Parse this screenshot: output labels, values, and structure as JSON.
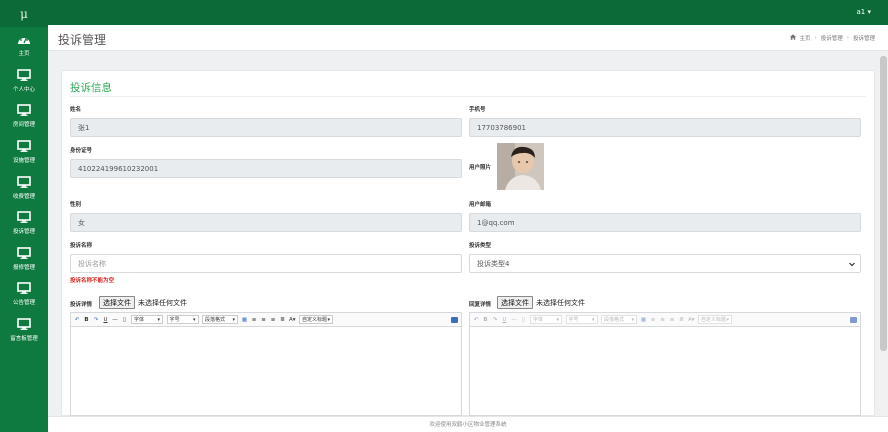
{
  "app": {
    "logo": "μ"
  },
  "sidebar": {
    "items": [
      {
        "label": "主页",
        "icon": "dashboard-icon"
      },
      {
        "label": "个人中心",
        "icon": "monitor-icon"
      },
      {
        "label": "房间管理",
        "icon": "monitor-icon"
      },
      {
        "label": "设施管理",
        "icon": "monitor-icon"
      },
      {
        "label": "收费管理",
        "icon": "monitor-icon"
      },
      {
        "label": "投诉管理",
        "icon": "monitor-icon"
      },
      {
        "label": "报修管理",
        "icon": "monitor-icon"
      },
      {
        "label": "公告管理",
        "icon": "monitor-icon"
      },
      {
        "label": "留言板管理",
        "icon": "monitor-icon"
      }
    ]
  },
  "header": {
    "user": "a1 ▾"
  },
  "page": {
    "title": "投诉管理",
    "breadcrumb": [
      "主页",
      "投诉管理",
      "投诉管理"
    ]
  },
  "form": {
    "title": "投诉信息",
    "name": {
      "label": "姓名",
      "value": "张1"
    },
    "phone": {
      "label": "手机号",
      "value": "17703786901"
    },
    "idcard": {
      "label": "身份证号",
      "value": "410224199610232001"
    },
    "photo": {
      "label": "用户照片"
    },
    "gender": {
      "label": "性别",
      "value": "女"
    },
    "email": {
      "label": "用户邮箱",
      "value": "1@qq.com"
    },
    "complaint_name": {
      "label": "投诉名称",
      "placeholder": "投诉名称",
      "error": "投诉名称不能为空"
    },
    "complaint_type": {
      "label": "投诉类型",
      "value": "投诉类型4"
    },
    "detail": {
      "label": "投诉详情",
      "file_button": "选择文件",
      "file_status": "未选择任何文件"
    },
    "reply": {
      "label": "回复详情",
      "file_button": "选择文件",
      "file_status": "未选择任何文件"
    }
  },
  "editor": {
    "font": "字体",
    "size": "字号",
    "paragraph": "段落格式",
    "custom_title": "自定义标题"
  },
  "footer": {
    "text": "欢迎使用双鹤小区物业管理系统"
  },
  "colors": {
    "sidebar": "#0e7a40",
    "accent": "#2eaa55",
    "error": "#d9241c"
  }
}
